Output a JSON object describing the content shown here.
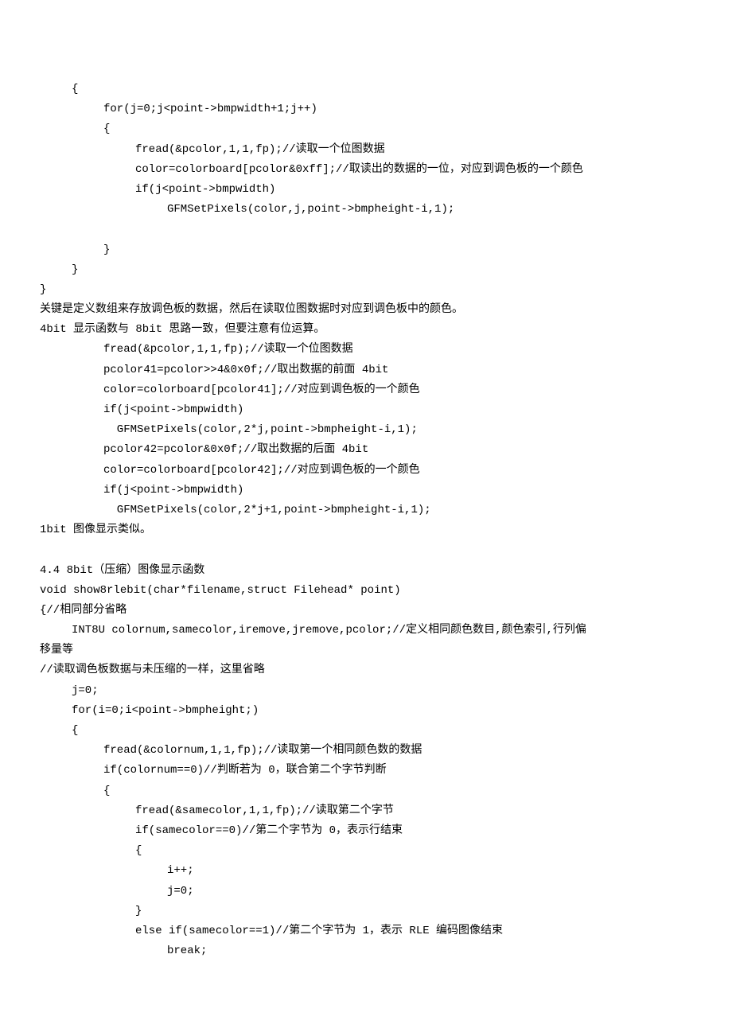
{
  "lines": [
    {
      "indent": 1,
      "text": "{"
    },
    {
      "indent": 2,
      "text": "for(j=0;j<point->bmpwidth+1;j++)"
    },
    {
      "indent": 2,
      "text": "{"
    },
    {
      "indent": 3,
      "text": "fread(&pcolor,1,1,fp);//读取一个位图数据"
    },
    {
      "indent": 3,
      "text": "color=colorboard[pcolor&0xff];//取读出的数据的一位，对应到调色板的一个颜色"
    },
    {
      "indent": 3,
      "text": "if(j<point->bmpwidth)"
    },
    {
      "indent": 4,
      "text": "GFMSetPixels(color,j,point->bmpheight-i,1);"
    },
    {
      "indent": 0,
      "blank": true
    },
    {
      "indent": 2,
      "text": "}"
    },
    {
      "indent": 1,
      "text": "}"
    },
    {
      "indent": 0,
      "text": "}"
    },
    {
      "indent": 0,
      "text": "关键是定义数组来存放调色板的数据，然后在读取位图数据时对应到调色板中的颜色。"
    },
    {
      "indent": 0,
      "text": "4bit 显示函数与 8bit 思路一致，但要注意有位运算。"
    },
    {
      "indent": 2,
      "text": "fread(&pcolor,1,1,fp);//读取一个位图数据"
    },
    {
      "indent": 2,
      "text": "pcolor41=pcolor>>4&0x0f;//取出数据的前面 4bit"
    },
    {
      "indent": 2,
      "text": "color=colorboard[pcolor41];//对应到调色板的一个颜色"
    },
    {
      "indent": 2,
      "text": "if(j<point->bmpwidth)"
    },
    {
      "indent": 2,
      "text": "  GFMSetPixels(color,2*j,point->bmpheight-i,1);"
    },
    {
      "indent": 2,
      "text": "pcolor42=pcolor&0x0f;//取出数据的后面 4bit"
    },
    {
      "indent": 2,
      "text": "color=colorboard[pcolor42];//对应到调色板的一个颜色"
    },
    {
      "indent": 2,
      "text": "if(j<point->bmpwidth)"
    },
    {
      "indent": 2,
      "text": "  GFMSetPixels(color,2*j+1,point->bmpheight-i,1);"
    },
    {
      "indent": 0,
      "text": "1bit 图像显示类似。"
    },
    {
      "indent": 0,
      "blank": true
    },
    {
      "indent": 0,
      "text": "4.4 8bit（压缩）图像显示函数"
    },
    {
      "indent": 0,
      "text": "void show8rlebit(char*filename,struct Filehead* point)"
    },
    {
      "indent": 0,
      "text": "{//相同部分省略"
    },
    {
      "indent": 1,
      "text": "INT8U colornum,samecolor,iremove,jremove,pcolor;//定义相同颜色数目,颜色索引,行列偏"
    },
    {
      "indent": 0,
      "text": "移量等"
    },
    {
      "indent": 0,
      "text": "//读取调色板数据与未压缩的一样，这里省略"
    },
    {
      "indent": 1,
      "text": "j=0;"
    },
    {
      "indent": 1,
      "text": "for(i=0;i<point->bmpheight;)"
    },
    {
      "indent": 1,
      "text": "{"
    },
    {
      "indent": 2,
      "text": "fread(&colornum,1,1,fp);//读取第一个相同颜色数的数据"
    },
    {
      "indent": 2,
      "text": "if(colornum==0)//判断若为 0，联合第二个字节判断"
    },
    {
      "indent": 2,
      "text": "{"
    },
    {
      "indent": 3,
      "text": "fread(&samecolor,1,1,fp);//读取第二个字节"
    },
    {
      "indent": 3,
      "text": "if(samecolor==0)//第二个字节为 0，表示行结束"
    },
    {
      "indent": 3,
      "text": "{"
    },
    {
      "indent": 4,
      "text": "i++;"
    },
    {
      "indent": 4,
      "text": "j=0;"
    },
    {
      "indent": 3,
      "text": "}"
    },
    {
      "indent": 3,
      "text": "else if(samecolor==1)//第二个字节为 1，表示 RLE 编码图像结束"
    },
    {
      "indent": 4,
      "text": "break;"
    }
  ]
}
